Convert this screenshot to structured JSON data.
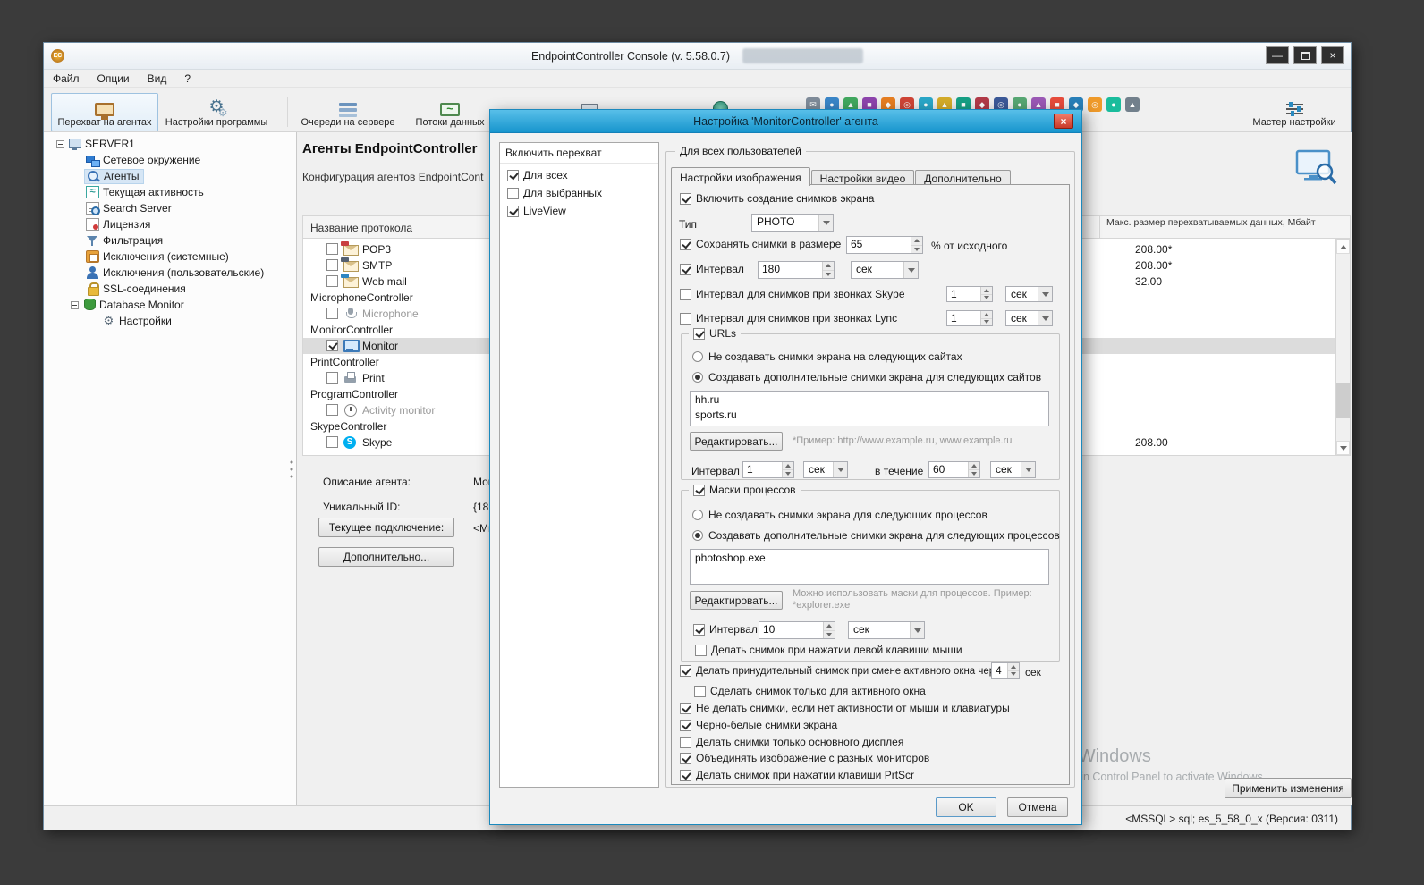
{
  "icons": {
    "gear": "⚙",
    "ec": "EC",
    "skype_letter": "S",
    "stream_wave": "~",
    "activity_wave": "≈"
  },
  "mini_icons": [
    "✉",
    "●",
    "▲",
    "■",
    "◆",
    "◎",
    "●",
    "▲",
    "■",
    "◆",
    "◎",
    "●",
    "▲",
    "■",
    "◆",
    "◎",
    "●",
    "▲"
  ],
  "window": {
    "title": "EndpointController Console (v. 5.58.0.7)",
    "menu": [
      "Файл",
      "Опции",
      "Вид",
      "?"
    ],
    "controls": {
      "minimize": "—",
      "close": "×"
    },
    "status_text": "<MSSQL> sql; es_5_58_0_x (Версия: 0311)",
    "apply_button": "Применить изменения"
  },
  "toolbar": {
    "intercept": "Перехват на агентах",
    "program_settings": "Настройки программы",
    "queues": "Очереди на сервере",
    "streams": "Потоки данных",
    "wizard": "Мастер настройки"
  },
  "tree": {
    "root": "SERVER1",
    "items": [
      "Сетевое окружение",
      "Агенты",
      "Текущая активность",
      "Search Server",
      "Лицензия",
      "Фильтрация",
      "Исключения (системные)",
      "Исключения (пользовательские)",
      "SSL-соединения",
      "Database Monitor",
      "Настройки"
    ]
  },
  "main": {
    "title": "Агенты EndpointController",
    "subtitle": "Конфигурация агентов EndpointCont",
    "table": {
      "col_protocol": "Название протокола",
      "col_size": "Макс. размер перехватываемых данных, Мбайт"
    },
    "agent": {
      "desc_label": "Описание агента:",
      "desc_value": "Мон",
      "id_label": "Уникальный ID:",
      "id_value": "{18",
      "conn_button": "Текущее подключение:",
      "conn_value": "<Ми",
      "more_button": "Дополнительно..."
    }
  },
  "protocols": [
    {
      "label": "POP3",
      "size": "208.00*"
    },
    {
      "label": "SMTP",
      "size": "208.00*"
    },
    {
      "label": "Web mail",
      "size": "32.00"
    },
    {
      "label": "MicrophoneController"
    },
    {
      "label": "Microphone"
    },
    {
      "label": "MonitorController"
    },
    {
      "label": "Monitor"
    },
    {
      "label": "PrintController"
    },
    {
      "label": "Print"
    },
    {
      "label": "ProgramController"
    },
    {
      "label": "Activity monitor"
    },
    {
      "label": "SkypeController"
    },
    {
      "label": "Skype",
      "size": "208.00"
    }
  ],
  "dialog": {
    "title": "Настройка 'MonitorController' агента",
    "close": "×",
    "capture": {
      "header": "Включить перехват",
      "items": [
        {
          "label": "Для всех"
        },
        {
          "label": "Для выбранных"
        },
        {
          "label": "LiveView"
        }
      ]
    },
    "group_label": "Для всех пользователей",
    "tabs": [
      "Настройки изображения",
      "Настройки видео",
      "Дополнительно"
    ],
    "img": {
      "enable": "Включить создание снимков экрана",
      "type_label": "Тип",
      "type_value": "PHOTO",
      "size_label": "Сохранять снимки в размере",
      "size_value": "65",
      "size_suffix": "% от исходного",
      "interval_label": "Интервал",
      "interval_value": "180",
      "interval_unit": "сек",
      "skype_label": "Интервал для снимков при звонках Skype",
      "skype_value": "1",
      "skype_unit": "сек",
      "lync_label": "Интервал для снимков при звонках Lync",
      "lync_value": "1",
      "lync_unit": "сек",
      "urls": {
        "title": "URLs",
        "no_option": "Не создавать снимки экрана на следующих сайтах",
        "yes_option": "Создавать дополнительные снимки экрана для следующих сайтов",
        "sites": "hh.ru\nsports.ru",
        "edit": "Редактировать...",
        "hint": "*Пример: http://www.example.ru, www.example.ru",
        "interval_label": "Интервал",
        "interval_value": "1",
        "interval_unit": "сек",
        "during_label": "в течение",
        "during_value": "60",
        "during_unit": "сек"
      },
      "masks": {
        "title": "Маски процессов",
        "no_option": "Не создавать снимки экрана для следующих процессов",
        "yes_option": "Создавать дополнительные снимки экрана для следующих процессов",
        "list": "photoshop.exe",
        "edit": "Редактировать...",
        "hint": "Можно использовать маски для процессов. Пример:\n*explorer.exe",
        "interval_label": "Интервал",
        "interval_value": "10",
        "interval_unit": "сек",
        "left_click": "Делать снимок при нажатии левой клавиши мыши"
      },
      "force_label": "Делать принудительный снимок при смене активного окна через",
      "force_value": "4",
      "force_unit": "сек",
      "active_only": "Сделать снимок только для активного окна",
      "no_idle": "Не делать снимки, если нет активности от мыши и клавиатуры",
      "bw": "Черно-белые снимки экрана",
      "primary_only": "Делать снимки только основного дисплея",
      "merge": "Объединять изображение с разных мониторов",
      "prtscr": "Делать снимок при нажатии клавиши PrtScr"
    },
    "ok": "OK",
    "cancel": "Отмена"
  },
  "watermark": {
    "line1": "Activate Windows",
    "line2": "Go to System in Control Panel to activate Windows"
  }
}
